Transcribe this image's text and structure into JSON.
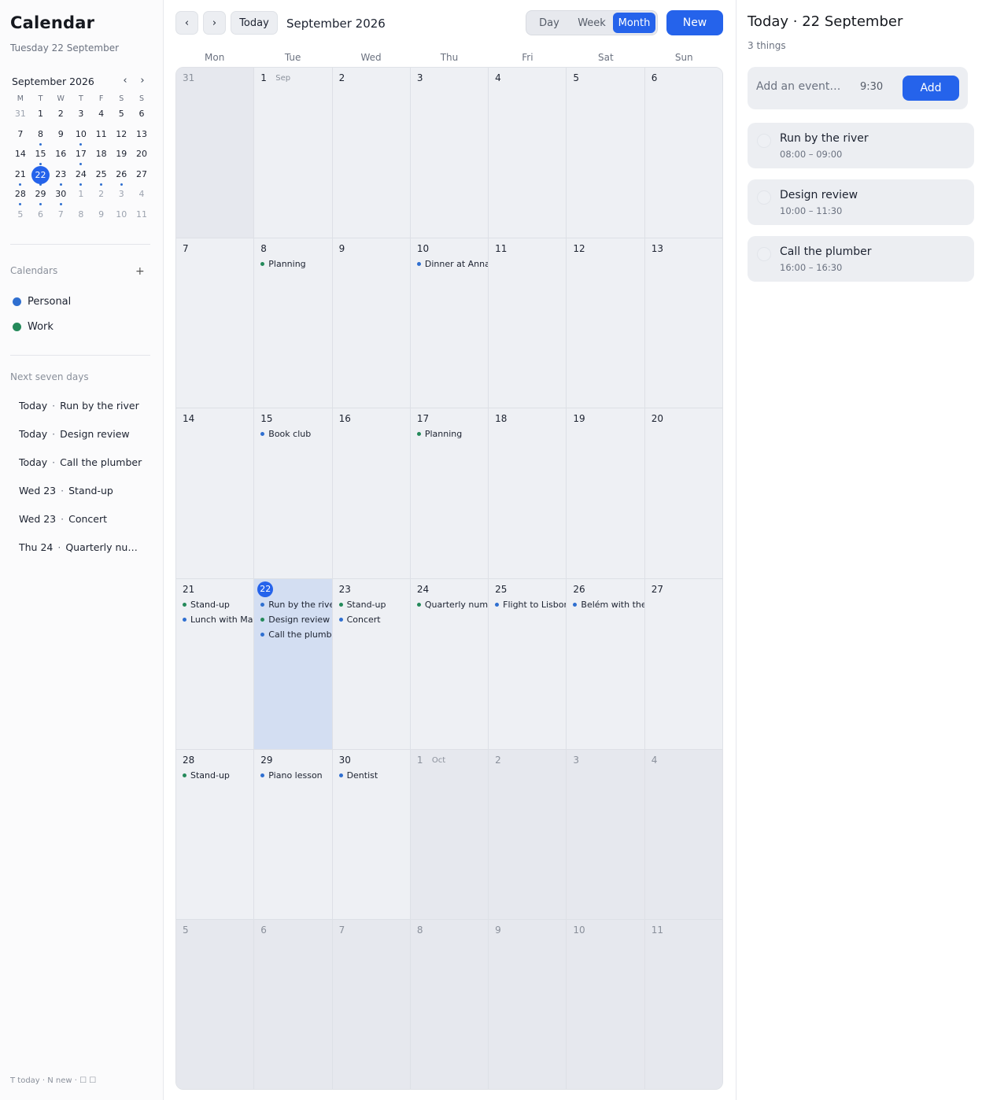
{
  "app": {
    "title": "Calendar",
    "subtitle": "Tuesday 22 September"
  },
  "mini": {
    "month_label": "September 2026",
    "prev": "‹",
    "next": "›",
    "weekday_initials": [
      "M",
      "T",
      "W",
      "T",
      "F",
      "S",
      "S"
    ],
    "weeks": [
      [
        {
          "n": "31",
          "out": true
        },
        {
          "n": "1"
        },
        {
          "n": "2"
        },
        {
          "n": "3"
        },
        {
          "n": "4"
        },
        {
          "n": "5"
        },
        {
          "n": "6"
        }
      ],
      [
        {
          "n": "7"
        },
        {
          "n": "8",
          "dot": true
        },
        {
          "n": "9"
        },
        {
          "n": "10",
          "dot": true
        },
        {
          "n": "11"
        },
        {
          "n": "12"
        },
        {
          "n": "13"
        }
      ],
      [
        {
          "n": "14"
        },
        {
          "n": "15",
          "dot": true
        },
        {
          "n": "16"
        },
        {
          "n": "17",
          "dot": true
        },
        {
          "n": "18"
        },
        {
          "n": "19"
        },
        {
          "n": "20"
        }
      ],
      [
        {
          "n": "21",
          "dot": true
        },
        {
          "n": "22",
          "today": true,
          "dot": true
        },
        {
          "n": "23",
          "dot": true
        },
        {
          "n": "24",
          "dot": true
        },
        {
          "n": "25",
          "dot": true
        },
        {
          "n": "26",
          "dot": true
        },
        {
          "n": "27"
        }
      ],
      [
        {
          "n": "28",
          "dot": true
        },
        {
          "n": "29",
          "dot": true
        },
        {
          "n": "30",
          "dot": true
        },
        {
          "n": "1",
          "out": true
        },
        {
          "n": "2",
          "out": true
        },
        {
          "n": "3",
          "out": true
        },
        {
          "n": "4",
          "out": true
        }
      ],
      [
        {
          "n": "5",
          "out": true
        },
        {
          "n": "6",
          "out": true
        },
        {
          "n": "7",
          "out": true
        },
        {
          "n": "8",
          "out": true
        },
        {
          "n": "9",
          "out": true
        },
        {
          "n": "10",
          "out": true
        },
        {
          "n": "11",
          "out": true
        }
      ]
    ]
  },
  "calendars": {
    "label": "Calendars",
    "add": "+",
    "items": [
      {
        "name": "Personal",
        "color": "#2f6fd0"
      },
      {
        "name": "Work",
        "color": "#24895a"
      }
    ]
  },
  "upcoming": {
    "label": "Next seven days",
    "items": [
      {
        "when": "Today",
        "what": "Run by the river"
      },
      {
        "when": "Today",
        "what": "Design review"
      },
      {
        "when": "Today",
        "what": "Call the plumber"
      },
      {
        "when": "Wed 23",
        "what": "Stand-up"
      },
      {
        "when": "Wed 23",
        "what": "Concert"
      },
      {
        "when": "Thu 24",
        "what": "Quarterly numbers"
      }
    ]
  },
  "footer": {
    "status": "T today · N new · ☐ ☐"
  },
  "toolbar": {
    "prev": "‹",
    "next": "›",
    "today": "Today",
    "title": "September 2026",
    "views": [
      "Day",
      "Week",
      "Month"
    ],
    "active_view": "Month",
    "new": "New"
  },
  "colors": {
    "personal": "#2f6fd0",
    "work": "#24895a",
    "accent": "#2563eb"
  },
  "month": {
    "weekdays": [
      "Mon",
      "Tue",
      "Wed",
      "Thu",
      "Fri",
      "Sat",
      "Sun"
    ],
    "weeks": [
      [
        {
          "n": "31",
          "out": true
        },
        {
          "n": "1",
          "tag": "Sep"
        },
        {
          "n": "2"
        },
        {
          "n": "3"
        },
        {
          "n": "4"
        },
        {
          "n": "5"
        },
        {
          "n": "6"
        }
      ],
      [
        {
          "n": "7"
        },
        {
          "n": "8",
          "events": [
            {
              "t": "Planning",
              "c": "work"
            }
          ]
        },
        {
          "n": "9"
        },
        {
          "n": "10",
          "events": [
            {
              "t": "Dinner at Anna's",
              "c": "personal"
            }
          ]
        },
        {
          "n": "11"
        },
        {
          "n": "12"
        },
        {
          "n": "13"
        }
      ],
      [
        {
          "n": "14"
        },
        {
          "n": "15",
          "events": [
            {
              "t": "Book club",
              "c": "personal"
            }
          ]
        },
        {
          "n": "16"
        },
        {
          "n": "17",
          "events": [
            {
              "t": "Planning",
              "c": "work"
            }
          ]
        },
        {
          "n": "18"
        },
        {
          "n": "19"
        },
        {
          "n": "20"
        }
      ],
      [
        {
          "n": "21",
          "events": [
            {
              "t": "Stand-up",
              "c": "work"
            },
            {
              "t": "Lunch with Maya",
              "c": "personal"
            }
          ]
        },
        {
          "n": "22",
          "today": true,
          "events": [
            {
              "t": "Run by the river",
              "c": "personal"
            },
            {
              "t": "Design review",
              "c": "work"
            },
            {
              "t": "Call the plumber",
              "c": "personal"
            }
          ]
        },
        {
          "n": "23",
          "events": [
            {
              "t": "Stand-up",
              "c": "work"
            },
            {
              "t": "Concert",
              "c": "personal"
            }
          ]
        },
        {
          "n": "24",
          "events": [
            {
              "t": "Quarterly numbers",
              "c": "work"
            }
          ]
        },
        {
          "n": "25",
          "events": [
            {
              "t": "Flight to Lisbon",
              "c": "personal"
            }
          ]
        },
        {
          "n": "26",
          "events": [
            {
              "t": "Belém with the",
              "c": "personal"
            }
          ]
        },
        {
          "n": "27"
        }
      ],
      [
        {
          "n": "28",
          "events": [
            {
              "t": "Stand-up",
              "c": "work"
            }
          ]
        },
        {
          "n": "29",
          "events": [
            {
              "t": "Piano lesson",
              "c": "personal"
            }
          ]
        },
        {
          "n": "30",
          "events": [
            {
              "t": "Dentist",
              "c": "personal"
            }
          ]
        },
        {
          "n": "1",
          "out": true,
          "tag": "Oct"
        },
        {
          "n": "2",
          "out": true
        },
        {
          "n": "3",
          "out": true
        },
        {
          "n": "4",
          "out": true
        }
      ],
      [
        {
          "n": "5",
          "out": true
        },
        {
          "n": "6",
          "out": true
        },
        {
          "n": "7",
          "out": true
        },
        {
          "n": "8",
          "out": true
        },
        {
          "n": "9",
          "out": true
        },
        {
          "n": "10",
          "out": true
        },
        {
          "n": "11",
          "out": true
        }
      ]
    ]
  },
  "right": {
    "title": "Today · 22 September",
    "subtitle": "3 things",
    "add_placeholder": "Add an event…",
    "add_time": "9:30",
    "add_button": "Add",
    "tasks": [
      {
        "title": "Run by the river",
        "time": "08:00 – 09:00"
      },
      {
        "title": "Design review",
        "time": "10:00 – 11:30"
      },
      {
        "title": "Call the plumber",
        "time": "16:00 – 16:30"
      }
    ]
  }
}
